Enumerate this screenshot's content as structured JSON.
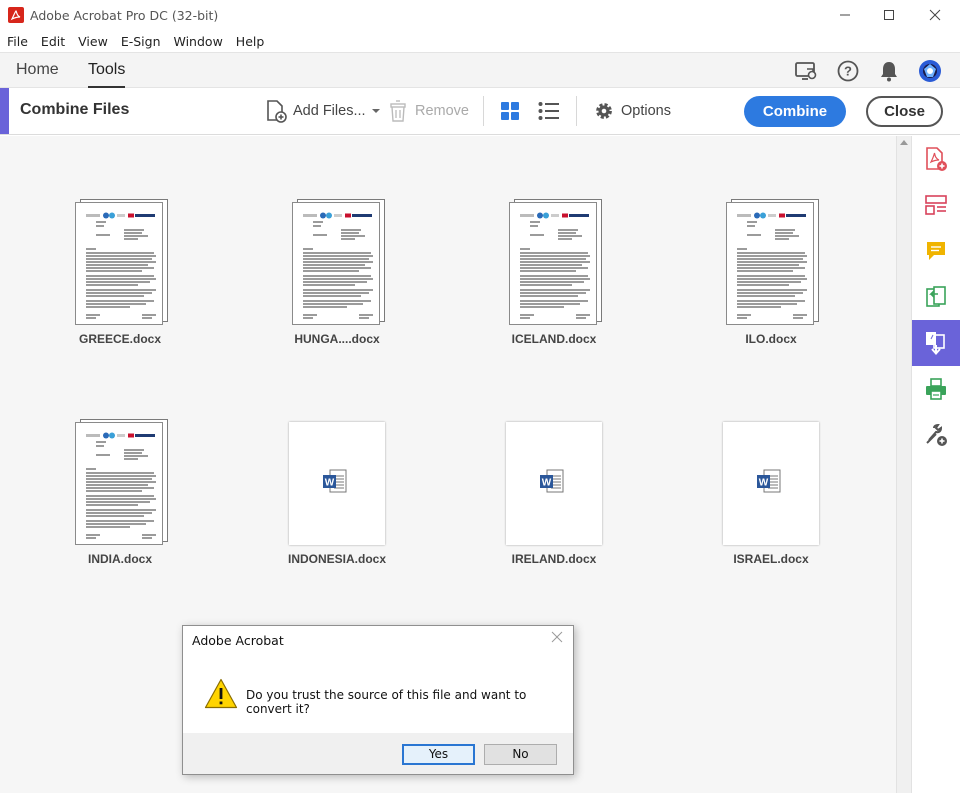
{
  "window": {
    "title": "Adobe Acrobat Pro DC (32-bit)",
    "controls": {
      "minimize": "—",
      "maximize": "☐",
      "close": "✕"
    }
  },
  "menu": [
    "File",
    "Edit",
    "View",
    "E-Sign",
    "Window",
    "Help"
  ],
  "tabs": {
    "home": "Home",
    "tools": "Tools"
  },
  "toolbar": {
    "title": "Combine Files",
    "add_files": "Add Files...",
    "remove": "Remove",
    "options": "Options",
    "combine": "Combine",
    "close": "Close"
  },
  "files": [
    {
      "name": "GREECE.docx",
      "preview": "document"
    },
    {
      "name": "HUNGA....docx",
      "preview": "document"
    },
    {
      "name": "ICELAND.docx",
      "preview": "document"
    },
    {
      "name": "ILO.docx",
      "preview": "document"
    },
    {
      "name": "INDIA.docx",
      "preview": "document"
    },
    {
      "name": "INDONESIA.docx",
      "preview": "word-icon"
    },
    {
      "name": "IRELAND.docx",
      "preview": "word-icon"
    },
    {
      "name": "ISRAEL.docx",
      "preview": "word-icon"
    }
  ],
  "right_panel_icons": [
    "create-pdf-icon",
    "organize-pages-icon",
    "comment-icon",
    "export-pdf-icon",
    "combine-files-icon",
    "print-production-icon",
    "more-tools-icon"
  ],
  "dialog": {
    "title": "Adobe Acrobat",
    "message": "Do you trust the source of this file and want to convert it?",
    "yes": "Yes",
    "no": "No"
  },
  "colors": {
    "accent": "#6a63d9",
    "primary_button": "#2d7ae0",
    "acrobat_red": "#d7261b"
  }
}
